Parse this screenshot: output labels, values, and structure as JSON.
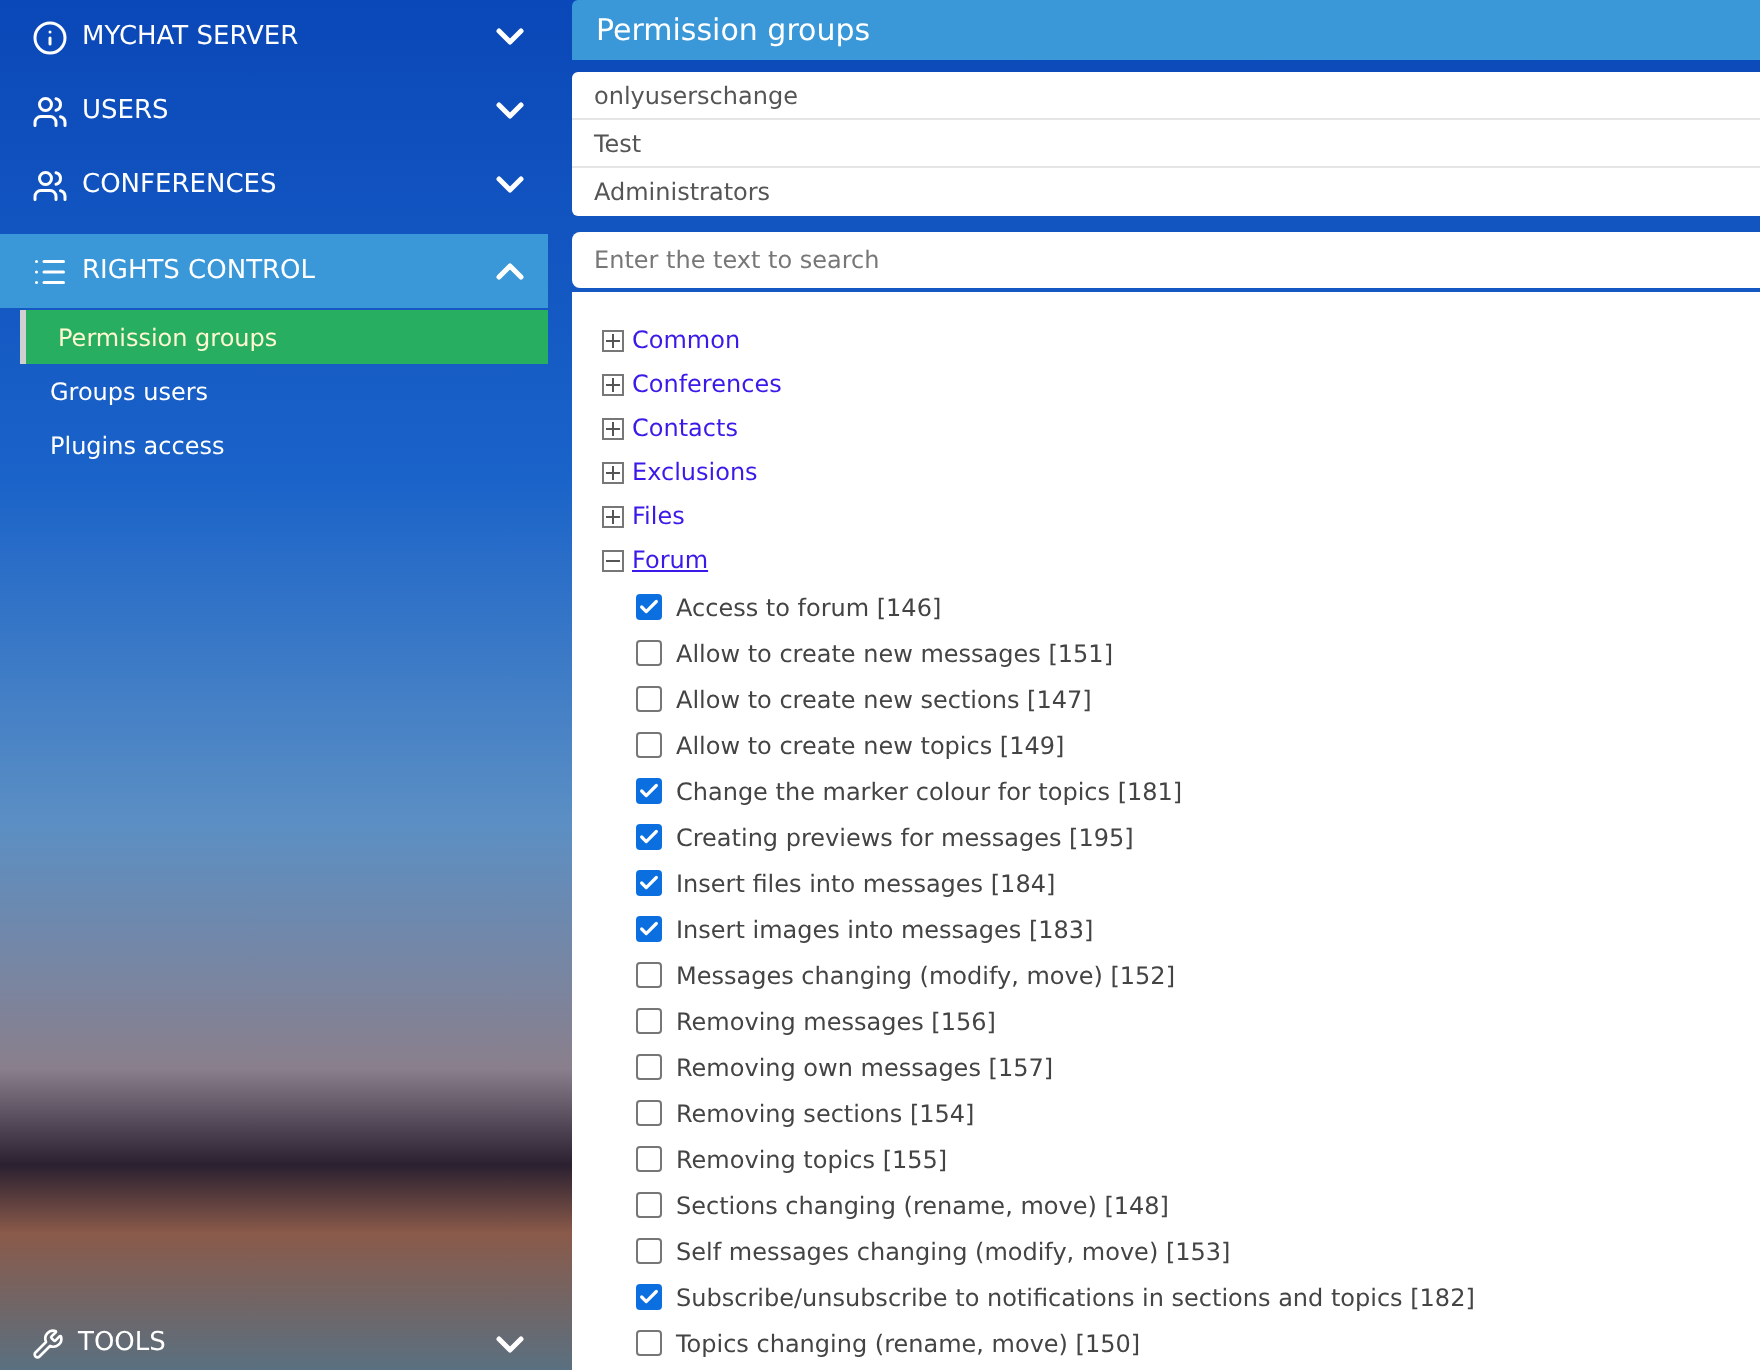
{
  "sidebar": {
    "sections": [
      {
        "label": "MYCHAT SERVER",
        "kind": "info",
        "expanded": false
      },
      {
        "label": "USERS",
        "kind": "users",
        "expanded": false
      },
      {
        "label": "CONFERENCES",
        "kind": "users",
        "expanded": false
      },
      {
        "label": "RIGHTS CONTROL",
        "kind": "list",
        "expanded": true,
        "children": [
          {
            "label": "Permission groups",
            "selected": true
          },
          {
            "label": "Groups users",
            "selected": false
          },
          {
            "label": "Plugins access",
            "selected": false
          }
        ]
      }
    ],
    "bottom_item": {
      "label": "TOOLS",
      "expanded": false
    }
  },
  "panel": {
    "title": "Permission groups",
    "groups": [
      "onlyuserschange",
      "Test",
      "Administrators"
    ],
    "search": {
      "placeholder": "Enter the text to search"
    },
    "tree": [
      {
        "label": "Common",
        "expanded": false
      },
      {
        "label": "Conferences",
        "expanded": false
      },
      {
        "label": "Contacts",
        "expanded": false
      },
      {
        "label": "Exclusions",
        "expanded": false
      },
      {
        "label": "Files",
        "expanded": false
      },
      {
        "label": "Forum",
        "expanded": true,
        "children": [
          {
            "label": "Access to forum [146]",
            "checked": true
          },
          {
            "label": "Allow to create new messages [151]",
            "checked": false
          },
          {
            "label": "Allow to create new sections [147]",
            "checked": false
          },
          {
            "label": "Allow to create new topics [149]",
            "checked": false
          },
          {
            "label": "Change the marker colour for topics [181]",
            "checked": true
          },
          {
            "label": "Creating previews for messages [195]",
            "checked": true
          },
          {
            "label": "Insert files into messages [184]",
            "checked": true
          },
          {
            "label": "Insert images into messages [183]",
            "checked": true
          },
          {
            "label": "Messages changing (modify, move) [152]",
            "checked": false
          },
          {
            "label": "Removing messages [156]",
            "checked": false
          },
          {
            "label": "Removing own messages [157]",
            "checked": false
          },
          {
            "label": "Removing sections [154]",
            "checked": false
          },
          {
            "label": "Removing topics [155]",
            "checked": false
          },
          {
            "label": "Sections changing (rename, move) [148]",
            "checked": false
          },
          {
            "label": "Self messages changing (modify, move) [153]",
            "checked": false
          },
          {
            "label": "Subscribe/unsubscribe to notifications in sections and topics [182]",
            "checked": true
          },
          {
            "label": "Topics changing (rename, move) [150]",
            "checked": false
          }
        ]
      }
    ]
  }
}
